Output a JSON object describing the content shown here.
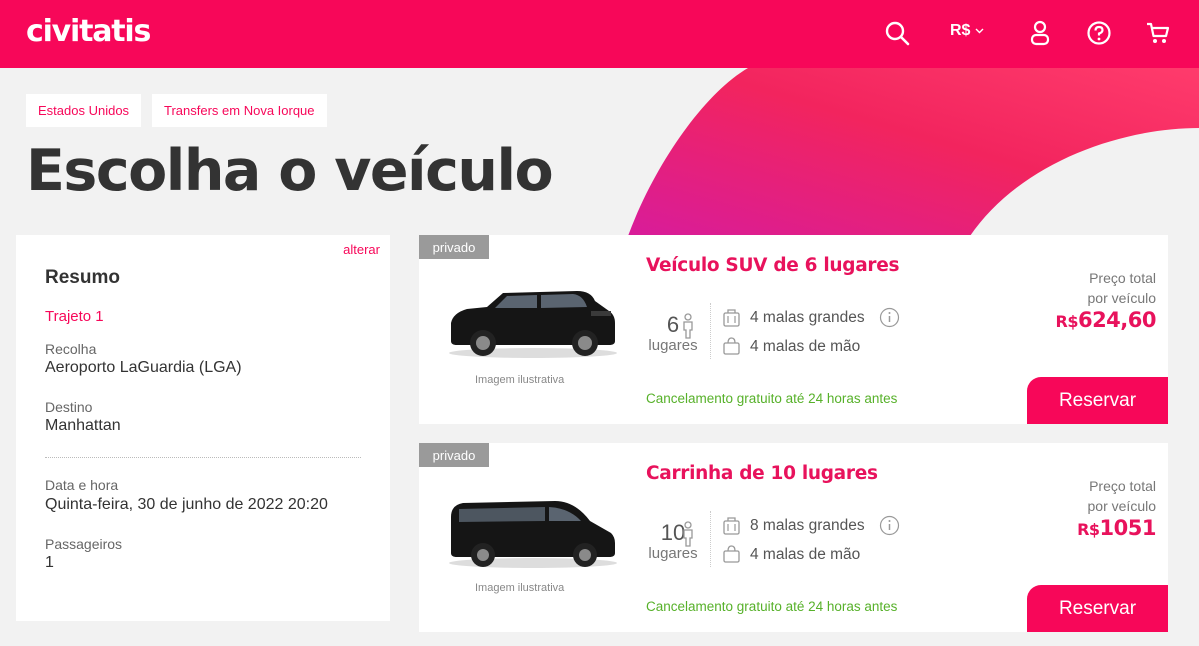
{
  "header": {
    "logo": "civitatis",
    "currency": "R$"
  },
  "breadcrumb": [
    "Estados Unidos",
    "Transfers em Nova Iorque"
  ],
  "page_title": "Escolha o veículo",
  "summary": {
    "change_link": "alterar",
    "heading": "Resumo",
    "route": "Trajeto 1",
    "pickup_label": "Recolha",
    "pickup_value": "Aeroporto LaGuardia (LGA)",
    "destination_label": "Destino",
    "destination_value": "Manhattan",
    "datetime_label": "Data e hora",
    "datetime_value": "Quinta-feira, 30 de junho de 2022 20:20",
    "passengers_label": "Passageiros",
    "passengers_value": "1"
  },
  "vehicles": [
    {
      "tag": "privado",
      "title": "Veículo SUV de 6 lugares",
      "seats": "6",
      "seats_label": "lugares",
      "large_bags": "4 malas grandes",
      "hand_bags": "4 malas de mão",
      "caption": "Imagem ilustrativa",
      "cancellation": "Cancelamento gratuito até 24 horas antes",
      "price_label_1": "Preço total",
      "price_label_2": "por veículo",
      "price_currency": "R$",
      "price_amount": "624,60",
      "reserve_label": "Reservar"
    },
    {
      "tag": "privado",
      "title": "Carrinha de 10 lugares",
      "seats": "10",
      "seats_label": "lugares",
      "large_bags": "8 malas grandes",
      "hand_bags": "4 malas de mão",
      "caption": "Imagem ilustrativa",
      "cancellation": "Cancelamento gratuito até 24 horas antes",
      "price_label_1": "Preço total",
      "price_label_2": "por veículo",
      "price_currency": "R$",
      "price_amount": "1051",
      "reserve_label": "Reservar"
    }
  ],
  "colors": {
    "brand": "#f70759",
    "title_pink": "#e8125c",
    "cancel_green": "#57b12a"
  },
  "icons": [
    "search-icon",
    "chevron-down-icon",
    "user-icon",
    "help-icon",
    "cart-icon",
    "person-icon",
    "suitcase-icon",
    "handbag-icon",
    "info-icon"
  ]
}
